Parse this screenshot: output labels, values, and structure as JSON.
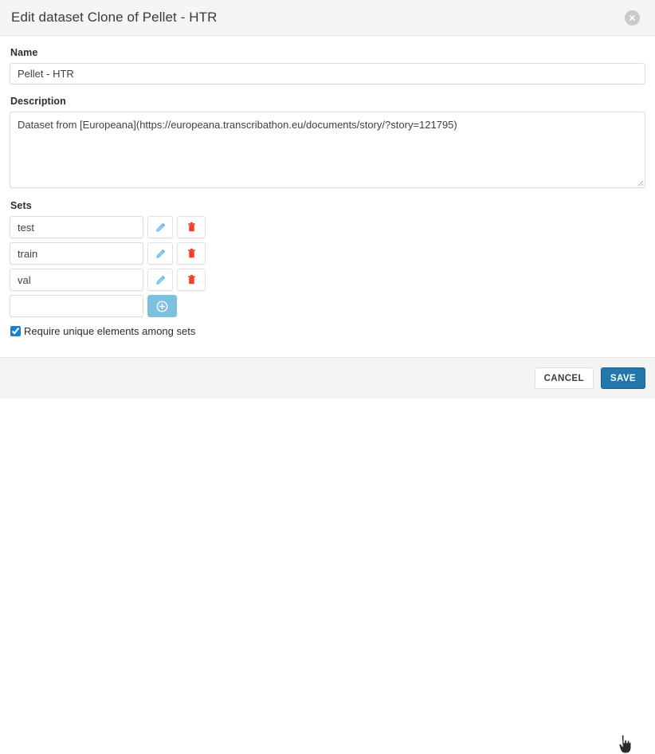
{
  "header": {
    "title": "Edit dataset Clone of Pellet - HTR",
    "close_icon": "close-circle-icon"
  },
  "form": {
    "name": {
      "label": "Name",
      "value": "Pellet - HTR",
      "placeholder": ""
    },
    "description": {
      "label": "Description",
      "value": "Dataset from [Europeana](https://europeana.transcribathon.eu/documents/story/?story=121795)",
      "placeholder": ""
    },
    "sets": {
      "label": "Sets",
      "items": [
        {
          "value": "test",
          "edit_icon": "pencil-icon",
          "delete_icon": "trash-icon"
        },
        {
          "value": "train",
          "edit_icon": "pencil-icon",
          "delete_icon": "trash-icon"
        },
        {
          "value": "val",
          "edit_icon": "pencil-icon",
          "delete_icon": "trash-icon"
        }
      ],
      "new_set": {
        "value": "",
        "placeholder": "",
        "add_icon": "plus-circle-icon"
      }
    },
    "unique_checkbox": {
      "label": "Require unique elements among sets",
      "checked": true
    }
  },
  "footer": {
    "cancel_label": "CANCEL",
    "save_label": "SAVE"
  },
  "colors": {
    "header_bg": "#f5f5f5",
    "save_button": "#2278ad",
    "add_button": "#7cc1e0",
    "delete_icon": "#fa3c28",
    "edit_icon": "#6cb9e8",
    "checkbox": "#1c7ed6"
  },
  "cursor": {
    "icon": "pointer-hand-cursor"
  }
}
